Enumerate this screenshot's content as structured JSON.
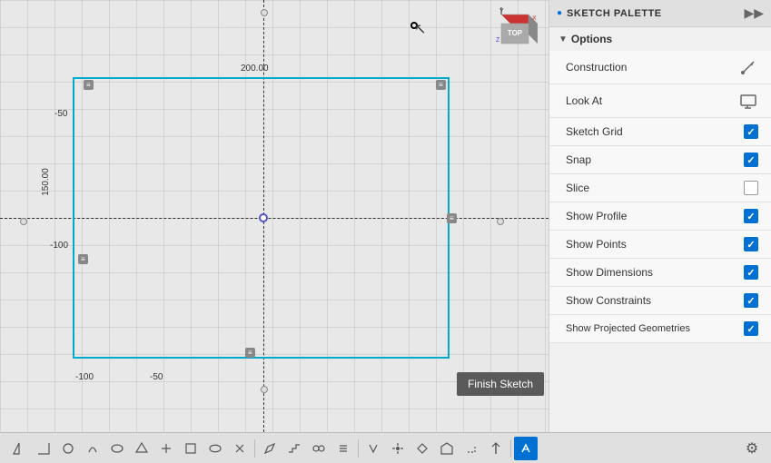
{
  "panel": {
    "title": "SKETCH PALETTE",
    "expand_icon": "▶",
    "sections": {
      "options": {
        "label": "Options",
        "arrow": "▼"
      }
    },
    "options": [
      {
        "id": "construction",
        "label": "Construction",
        "type": "icon",
        "checked": null
      },
      {
        "id": "look_at",
        "label": "Look At",
        "type": "icon",
        "checked": null
      },
      {
        "id": "sketch_grid",
        "label": "Sketch Grid",
        "type": "checkbox",
        "checked": true
      },
      {
        "id": "snap",
        "label": "Snap",
        "type": "checkbox",
        "checked": true
      },
      {
        "id": "slice",
        "label": "Slice",
        "type": "checkbox",
        "checked": false
      },
      {
        "id": "show_profile",
        "label": "Show Profile",
        "type": "checkbox",
        "checked": true
      },
      {
        "id": "show_points",
        "label": "Show Points",
        "type": "checkbox",
        "checked": true
      },
      {
        "id": "show_dimensions",
        "label": "Show Dimensions",
        "type": "checkbox",
        "checked": true
      },
      {
        "id": "show_constraints",
        "label": "Show Constraints",
        "type": "checkbox",
        "checked": true
      },
      {
        "id": "show_projected_geometries",
        "label": "Show Projected Geometries",
        "type": "checkbox",
        "checked": true
      }
    ]
  },
  "canvas": {
    "dim_top": "200.00",
    "dim_left_top": "-50",
    "dim_left_main": "150.00",
    "dim_left_2": "-100",
    "dim_bottom_1": "-50",
    "dim_bottom_2": "-100"
  },
  "finish_sketch": {
    "label": "Finish Sketch"
  },
  "viewport": {
    "label": "TOP",
    "x_axis": "X",
    "y_axis": "Y",
    "z_axis": "Z"
  },
  "toolbar": {
    "tools": [
      "⌒",
      "⌒",
      "⌒",
      "⌒",
      "⌒",
      "⌒",
      "⌒",
      "⌒",
      "⌒",
      "⌒",
      "⌒",
      "⌒",
      "⌒",
      "⌒",
      "⌒",
      "⌒",
      "⌒",
      "⌒",
      "⌒",
      "⌒",
      "⌒",
      "⌒"
    ],
    "settings_icon": "⚙"
  }
}
